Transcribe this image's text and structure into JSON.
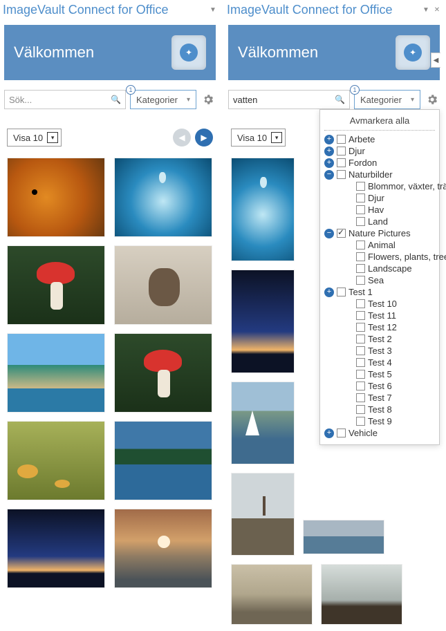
{
  "left": {
    "title": "ImageVault Connect for Office",
    "welcome": "Välkommen",
    "search_placeholder": "Sök...",
    "search_value": "",
    "cat_badge": "1",
    "cat_label": "Kategorier",
    "visa_label": "Visa 10"
  },
  "right": {
    "title": "ImageVault Connect for Office",
    "welcome": "Välkommen",
    "search_placeholder": "",
    "search_value": "vatten",
    "cat_badge": "1",
    "cat_label": "Kategorier",
    "visa_label": "Visa 10",
    "deselect_all": "Avmarkera alla",
    "tree": [
      {
        "exp": "plus",
        "indent": 0,
        "checked": false,
        "label": "Arbete"
      },
      {
        "exp": "plus",
        "indent": 0,
        "checked": false,
        "label": "Djur"
      },
      {
        "exp": "plus",
        "indent": 0,
        "checked": false,
        "label": "Fordon"
      },
      {
        "exp": "minus",
        "indent": 0,
        "checked": false,
        "label": "Naturbilder"
      },
      {
        "exp": "none",
        "indent": 1,
        "checked": false,
        "label": "Blommor, växter, träd"
      },
      {
        "exp": "none",
        "indent": 1,
        "checked": false,
        "label": "Djur"
      },
      {
        "exp": "none",
        "indent": 1,
        "checked": false,
        "label": "Hav"
      },
      {
        "exp": "none",
        "indent": 1,
        "checked": false,
        "label": "Land"
      },
      {
        "exp": "minus",
        "indent": 0,
        "checked": true,
        "label": "Nature Pictures"
      },
      {
        "exp": "none",
        "indent": 1,
        "checked": false,
        "label": "Animal"
      },
      {
        "exp": "none",
        "indent": 1,
        "checked": false,
        "label": "Flowers, plants, trees"
      },
      {
        "exp": "none",
        "indent": 1,
        "checked": false,
        "label": "Landscape"
      },
      {
        "exp": "none",
        "indent": 1,
        "checked": false,
        "label": "Sea"
      },
      {
        "exp": "plus",
        "indent": 0,
        "checked": false,
        "label": "Test 1"
      },
      {
        "exp": "none",
        "indent": 1,
        "checked": false,
        "label": "Test 10"
      },
      {
        "exp": "none",
        "indent": 1,
        "checked": false,
        "label": "Test 11"
      },
      {
        "exp": "none",
        "indent": 1,
        "checked": false,
        "label": "Test 12"
      },
      {
        "exp": "none",
        "indent": 1,
        "checked": false,
        "label": "Test 2"
      },
      {
        "exp": "none",
        "indent": 1,
        "checked": false,
        "label": "Test 3"
      },
      {
        "exp": "none",
        "indent": 1,
        "checked": false,
        "label": "Test 4"
      },
      {
        "exp": "none",
        "indent": 1,
        "checked": false,
        "label": "Test 5"
      },
      {
        "exp": "none",
        "indent": 1,
        "checked": false,
        "label": "Test 6"
      },
      {
        "exp": "none",
        "indent": 1,
        "checked": false,
        "label": "Test 7"
      },
      {
        "exp": "none",
        "indent": 1,
        "checked": false,
        "label": "Test 8"
      },
      {
        "exp": "none",
        "indent": 1,
        "checked": false,
        "label": "Test 9"
      },
      {
        "exp": "plus",
        "indent": 0,
        "checked": false,
        "label": "Vehicle"
      }
    ]
  }
}
